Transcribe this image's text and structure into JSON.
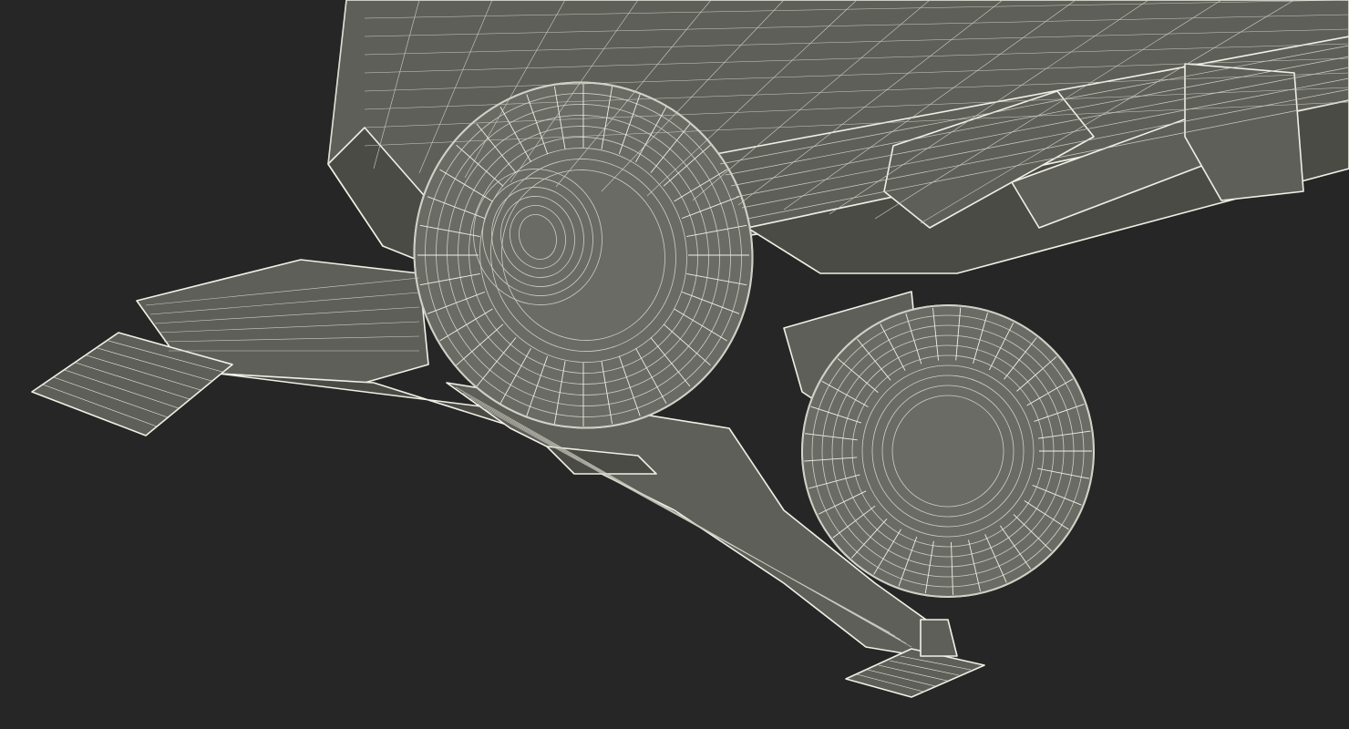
{
  "scene": {
    "subject": "wireframe-undercarriage-render",
    "colors": {
      "background": "#262626",
      "body_fill": "#5e5f59",
      "body_fill_dark": "#4a4b45",
      "tire_fill": "#6a6b65",
      "wire": "#f1f0e6",
      "wire_dim": "#cfcec4"
    }
  }
}
